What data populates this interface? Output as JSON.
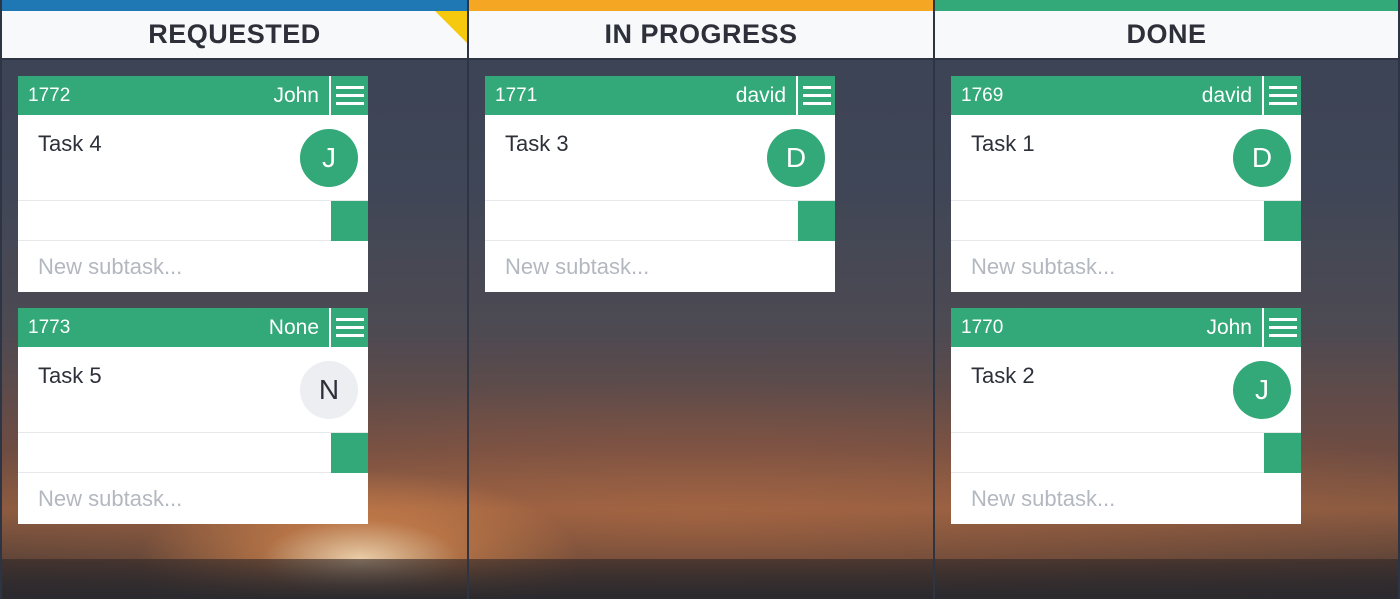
{
  "board": {
    "columns": [
      {
        "title": "REQUESTED",
        "color": "#1f78b4",
        "cards": [
          {
            "id": "1772",
            "user": "John",
            "title": "Task 4",
            "avatar": "J",
            "avatar_color": "#33a878",
            "subtask_placeholder": "New subtask..."
          },
          {
            "id": "1773",
            "user": "None",
            "title": "Task 5",
            "avatar": "N",
            "avatar_color": "#eceef1",
            "subtask_placeholder": "New subtask..."
          }
        ]
      },
      {
        "title": "IN PROGRESS",
        "color": "#f5a623",
        "cards": [
          {
            "id": "1771",
            "user": "david",
            "title": "Task 3",
            "avatar": "D",
            "avatar_color": "#33a878",
            "subtask_placeholder": "New subtask..."
          }
        ]
      },
      {
        "title": "DONE",
        "color": "#33a878",
        "cards": [
          {
            "id": "1769",
            "user": "david",
            "title": "Task 1",
            "avatar": "D",
            "avatar_color": "#33a878",
            "subtask_placeholder": "New subtask..."
          },
          {
            "id": "1770",
            "user": "John",
            "title": "Task 2",
            "avatar": "J",
            "avatar_color": "#33a878",
            "subtask_placeholder": "New subtask..."
          }
        ]
      }
    ]
  },
  "icons": {
    "card_menu": "hamburger-menu-icon",
    "corner_flag": "corner-flag-icon"
  },
  "colors": {
    "card_header": "#33a878",
    "corner_flag": "#f6c90e"
  }
}
